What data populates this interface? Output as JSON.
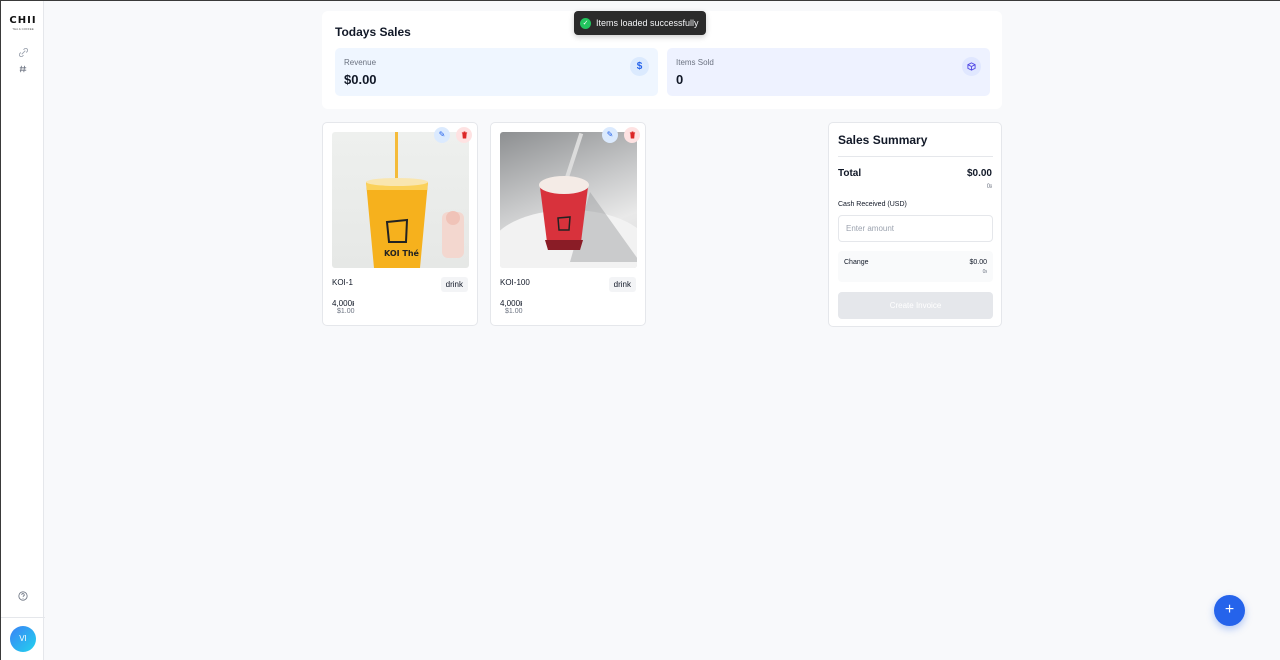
{
  "sidebar": {
    "logo_text": "CHII",
    "logo_tagline": "TEA & COFFEE",
    "nav": [
      {
        "icon": "link-icon"
      },
      {
        "icon": "hash-icon"
      }
    ],
    "help_icon": "help-circle-icon",
    "avatar_initials": "VI"
  },
  "toast": {
    "message": "Items loaded successfully",
    "icon": "check-circle-icon"
  },
  "today_sales": {
    "title": "Todays Sales",
    "revenue_label": "Revenue",
    "revenue_value": "$0.00",
    "revenue_icon": "dollar-icon",
    "items_sold_label": "Items Sold",
    "items_sold_value": "0",
    "items_icon": "box-icon"
  },
  "products": [
    {
      "name": "KOI-1",
      "category": "drink",
      "price_riel": "4,000៛",
      "price_usd": "$1.00"
    },
    {
      "name": "KOI-100",
      "category": "drink",
      "price_riel": "4,000៛",
      "price_usd": "$1.00"
    }
  ],
  "summary": {
    "title": "Sales Summary",
    "total_label": "Total",
    "total_value": "$0.00",
    "total_riel": "0៛",
    "cash_label": "Cash Received (USD)",
    "cash_placeholder": "Enter amount",
    "change_label": "Change",
    "change_value": "$0.00",
    "change_riel": "0៛",
    "create_button": "Create Invoice"
  },
  "fab_label": "+",
  "colors": {
    "accent": "#2563eb",
    "success": "#22c55e",
    "danger": "#dc2626"
  }
}
